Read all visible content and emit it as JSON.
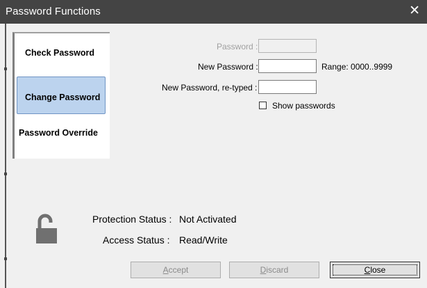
{
  "window": {
    "title": "Password Functions",
    "close_glyph": "✕"
  },
  "tabs": [
    {
      "label": "Check Password",
      "selected": false
    },
    {
      "label": "Change Password",
      "selected": true
    },
    {
      "label": "Password Override",
      "selected": false
    }
  ],
  "form": {
    "password_label": "Password :",
    "new_password_label": "New Password :",
    "retyped_label": "New Password, re-typed :",
    "range_label": "Range: 0000..9999",
    "show_passwords_label": "Show passwords",
    "show_passwords_checked": false,
    "password_value": "",
    "new_password_value": "",
    "retyped_value": ""
  },
  "status": {
    "protection_label": "Protection Status :",
    "protection_value": "Not Activated",
    "access_label": "Access Status :",
    "access_value": "Read/Write",
    "lock_icon": "unlocked-padlock-icon"
  },
  "buttons": {
    "accept": {
      "mnemonic": "A",
      "rest": "ccept",
      "enabled": false
    },
    "discard": {
      "mnemonic": "D",
      "rest": "iscard",
      "enabled": false
    },
    "close": {
      "mnemonic": "C",
      "rest": "lose",
      "enabled": true
    }
  },
  "colors": {
    "titlebar": "#444444",
    "selected_tab": "#bcd3ee",
    "window_bg": "#f0f0f0",
    "lock_gray": "#707070"
  }
}
